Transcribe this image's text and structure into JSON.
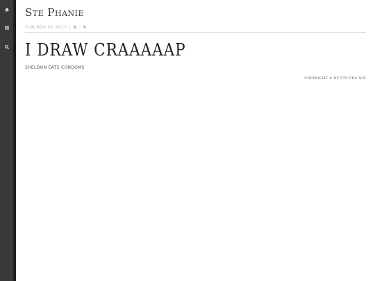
{
  "sidebar": {
    "items": [
      {
        "icon": "home-icon"
      },
      {
        "icon": "menu-icon"
      },
      {
        "icon": "search-icon"
      }
    ]
  },
  "header": {
    "site_title": "Ste Phanie",
    "date": "Sun Nov 01 2015",
    "separator": "|"
  },
  "post": {
    "title": "I draw craaaaap",
    "body": "Sheldon eats condoms"
  },
  "footer": {
    "copyright": "Copyright © by Ste Pha Nie"
  },
  "colors": {
    "sidebar_bg": "#3a3a3a",
    "sidebar_border": "#1f1f1f",
    "meta_text": "#b8b8b8"
  }
}
